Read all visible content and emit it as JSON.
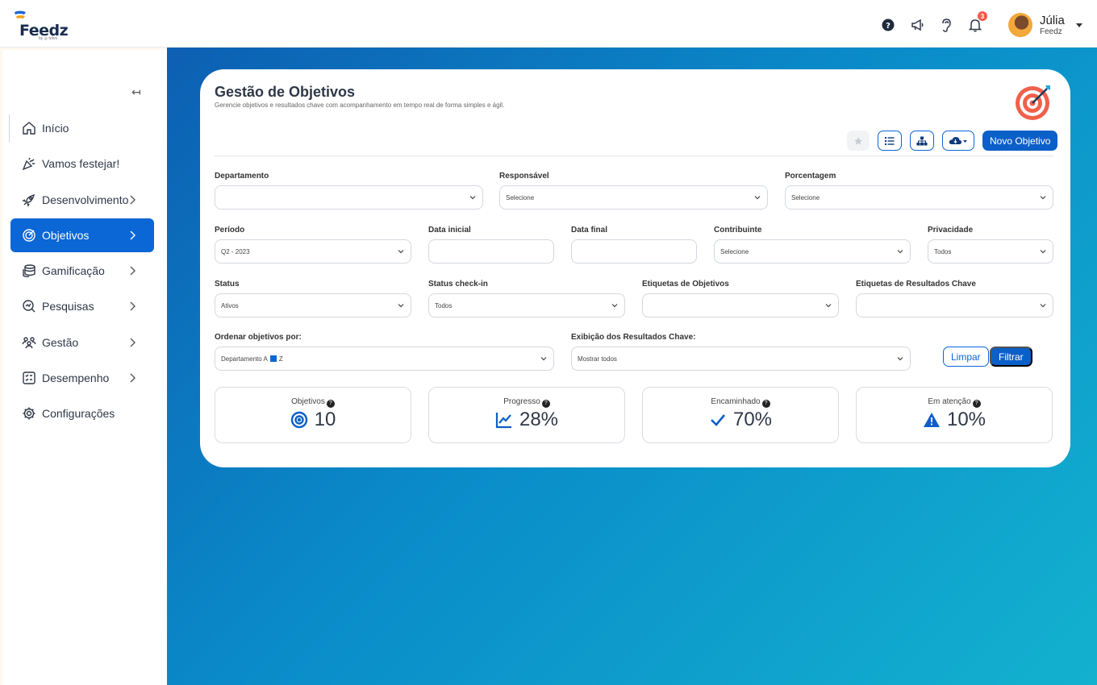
{
  "brand": {
    "name": "Feedz",
    "by": "by ◎ totvs"
  },
  "header": {
    "help_icon": "help-icon",
    "notif_count": "3",
    "user_name": "Júlia",
    "user_company": "Feedz"
  },
  "sidebar": {
    "collapse": "↤",
    "items": [
      {
        "label": "Início",
        "icon": "home-icon"
      },
      {
        "label": "Vamos festejar!",
        "icon": "party-icon"
      },
      {
        "label": "Desenvolvimento",
        "icon": "rocket-icon"
      },
      {
        "label": "Objetivos",
        "icon": "target-icon"
      },
      {
        "label": "Gamificação",
        "icon": "coins-icon"
      },
      {
        "label": "Pesquisas",
        "icon": "search-icon"
      },
      {
        "label": "Gestão",
        "icon": "people-icon"
      },
      {
        "label": "Desempenho",
        "icon": "checklist-icon"
      },
      {
        "label": "Configurações",
        "icon": "gear-icon"
      }
    ]
  },
  "page": {
    "title": "Gestão de Objetivos",
    "subtitle": "Gerencie objetivos e resultados chave com acompanhamento em tempo real de forma simples e ágil.",
    "new_button": "Novo Objetivo"
  },
  "filters": {
    "departamento": {
      "label": "Departamento",
      "value": ""
    },
    "responsavel": {
      "label": "Responsável",
      "value": "Selecione"
    },
    "porcentagem": {
      "label": "Porcentagem",
      "value": "Selecione"
    },
    "periodo": {
      "label": "Período",
      "value": "Q2 - 2023"
    },
    "data_inicial": {
      "label": "Data inicial",
      "value": ""
    },
    "data_final": {
      "label": "Data final",
      "value": ""
    },
    "contribuinte": {
      "label": "Contribuinte",
      "value": "Selecione"
    },
    "privacidade": {
      "label": "Privacidade",
      "value": "Todos"
    },
    "status": {
      "label": "Status",
      "value": "Ativos"
    },
    "status_checkin": {
      "label": "Status check-in",
      "value": "Todos"
    },
    "etiquetas_obj": {
      "label": "Etiquetas de Objetivos",
      "value": ""
    },
    "etiquetas_kr": {
      "label": "Etiquetas de Resultados Chave",
      "value": ""
    },
    "ordenar": {
      "label": "Ordenar objetivos por:",
      "value_a": "Departamento A",
      "value_b": "Z"
    },
    "exibicao": {
      "label": "Exibição dos Resultados Chave:",
      "value": "Mostrar todos"
    },
    "clear_button": "Limpar",
    "filter_button": "Filtrar"
  },
  "stats": [
    {
      "label": "Objetivos",
      "value": "10",
      "icon": "target-icon"
    },
    {
      "label": "Progresso",
      "value": "28%",
      "icon": "chart-line-icon"
    },
    {
      "label": "Encaminhado",
      "value": "70%",
      "icon": "check-icon"
    },
    {
      "label": "Em atenção",
      "value": "10%",
      "icon": "warning-icon"
    }
  ],
  "colors": {
    "primary": "#0b5fc8",
    "gradient_start": "#0d5fb3",
    "gradient_end": "#13b2cf",
    "badge": "#f25a4a"
  }
}
